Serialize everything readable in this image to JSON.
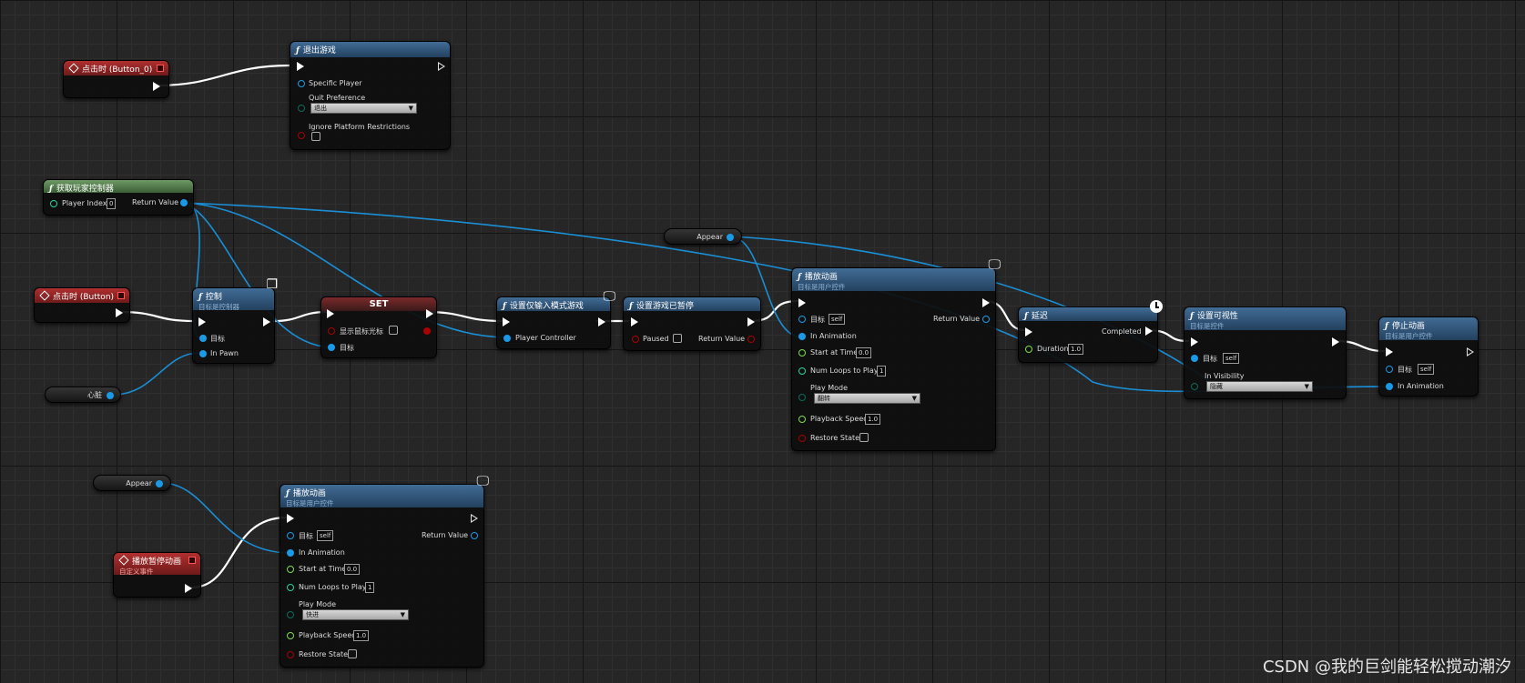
{
  "nodes": {
    "quit": {
      "title": "退出游戏",
      "pin_player": "Specific Player",
      "pin_quit_pref": "Quit Preference",
      "quit_pref_value": "退出",
      "pin_ignore": "Ignore Platform Restrictions"
    },
    "onclick0": {
      "title": "点击时 (Button_0)"
    },
    "getpc": {
      "title": "获取玩家控制器",
      "pin_index": "Player Index",
      "index_value": "0",
      "pin_return": "Return Value"
    },
    "onclick": {
      "title": "点击时 (Button)"
    },
    "control": {
      "title": "控制",
      "subtitle": "目标是控制器",
      "pin_target": "目标",
      "pin_pawn": "In Pawn"
    },
    "xinzang": {
      "label": "心脏"
    },
    "set": {
      "title": "SET",
      "pin_show_cursor": "显示鼠标光标",
      "pin_target": "目标"
    },
    "uimode": {
      "title": "设置仅输入模式游戏",
      "pin_pc": "Player Controller"
    },
    "paused": {
      "title": "设置游戏已暂停",
      "pin_paused": "Paused",
      "pin_return": "Return Value"
    },
    "appear1": {
      "label": "Appear"
    },
    "play1": {
      "title": "播放动画",
      "subtitle": "目标是用户控件",
      "pin_target": "目标",
      "target_value": "self",
      "pin_anim": "In Animation",
      "pin_start": "Start at Time",
      "start_value": "0.0",
      "pin_loops": "Num Loops to Play",
      "loops_value": "1",
      "pin_mode": "Play Mode",
      "mode_value": "翻转",
      "pin_speed": "Playback Speed",
      "speed_value": "1.0",
      "pin_restore": "Restore State",
      "pin_return": "Return Value"
    },
    "delay": {
      "title": "延迟",
      "pin_completed": "Completed",
      "pin_duration": "Duration",
      "duration_value": "1.0"
    },
    "visibility": {
      "title": "设置可视性",
      "subtitle": "目标是控件",
      "pin_target": "目标",
      "target_value": "self",
      "pin_vis": "In Visibility",
      "vis_value": "隐藏"
    },
    "stop": {
      "title": "停止动画",
      "subtitle": "目标是用户控件",
      "pin_target": "目标",
      "target_value": "self",
      "pin_anim": "In Animation"
    },
    "appear2": {
      "label": "Appear"
    },
    "custom": {
      "title": "播放暂停动画",
      "subtitle": "自定义事件"
    },
    "play2": {
      "title": "播放动画",
      "subtitle": "目标是用户控件",
      "pin_target": "目标",
      "target_value": "self",
      "pin_anim": "In Animation",
      "pin_start": "Start at Time",
      "start_value": "0.0",
      "pin_loops": "Num Loops to Play",
      "loops_value": "1",
      "pin_mode": "Play Mode",
      "mode_value": "快进",
      "pin_speed": "Playback Speed",
      "speed_value": "1.0",
      "pin_restore": "Restore State",
      "pin_return": "Return Value"
    }
  },
  "icons": {
    "function": "ƒ",
    "monitor": "🖵",
    "clock": "clock-icon",
    "event": "diamond-icon"
  },
  "colors": {
    "exec": "#ffffff",
    "object": "#1a9ae6",
    "float": "#7ddc4f",
    "int": "#28d29a",
    "bool": "#aa0000",
    "function_header": "#2f5478",
    "event_header": "#8f2424",
    "pure_header": "#4e7a47"
  },
  "watermark": "CSDN @我的巨剑能轻松搅动潮汐"
}
